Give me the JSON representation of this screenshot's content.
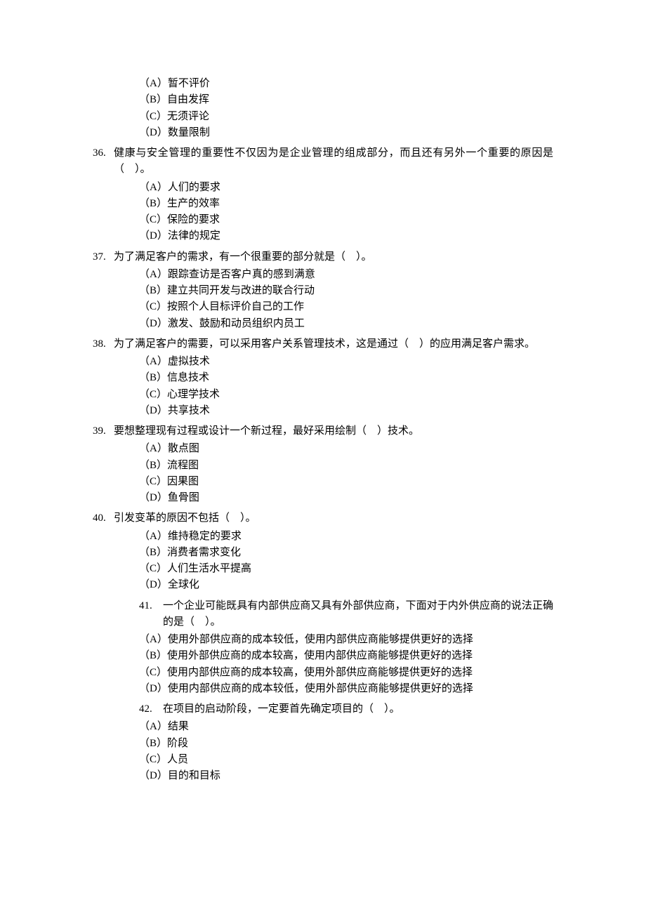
{
  "orphan_options": [
    "（A）暂不评价",
    "（B）自由发挥",
    "（C）无须评论",
    "（D）数量限制"
  ],
  "questions": [
    {
      "num": "36.",
      "stem": "健康与安全管理的重要性不仅因为是企业管理的组成部分，而且还有另外一个重要的原因是（　）。",
      "opts": [
        "（A）人们的要求",
        "（B）生产的效率",
        "（C）保险的要求",
        "（D）法律的规定"
      ]
    },
    {
      "num": "37.",
      "stem": "为了满足客户的需求，有一个很重要的部分就是（　）。",
      "opts": [
        "（A）跟踪查访是否客户真的感到满意",
        "（B）建立共同开发与改进的联合行动",
        "（C）按照个人目标评价自己的工作",
        "（D）激发、鼓励和动员组织内员工"
      ]
    },
    {
      "num": "38.",
      "stem": "为了满足客户的需要，可以采用客户关系管理技术，这是通过（　）的应用满足客户需求。",
      "opts": [
        "（A）虚拟技术",
        "（B）信息技术",
        "（C）心理学技术",
        "（D）共享技术"
      ]
    },
    {
      "num": "39.",
      "stem": "要想整理现有过程或设计一个新过程，最好采用绘制（　）技术。",
      "opts": [
        "（A）散点图",
        "（B）流程图",
        "（C）因果图",
        "（D）鱼骨图"
      ]
    },
    {
      "num": "40.",
      "stem": "引发变革的原因不包括（　）。",
      "opts": [
        "（A）维持稳定的要求",
        "（B）消费者需求变化",
        "（C）人们生活水平提高",
        "（D）全球化"
      ]
    }
  ],
  "indented_questions": [
    {
      "num": "41.",
      "stem": "一个企业可能既具有内部供应商又具有外部供应商，下面对于内外供应商的说法正确的是（　）。",
      "opts": [
        "（A）使用外部供应商的成本较低，使用内部供应商能够提供更好的选择",
        "（B）使用外部供应商的成本较高，使用内部供应商能够提供更好的选择",
        "（C）使用内部供应商的成本较高，使用外部供应商能够提供更好的选择",
        "（D）使用内部供应商的成本较低，使用外部供应商能够提供更好的选择"
      ]
    },
    {
      "num": "42.",
      "stem": "在项目的启动阶段，一定要首先确定项目的（　）。",
      "opts": [
        "（A）结果",
        "（B）阶段",
        "（C）人员",
        "（D）目的和目标"
      ]
    }
  ]
}
